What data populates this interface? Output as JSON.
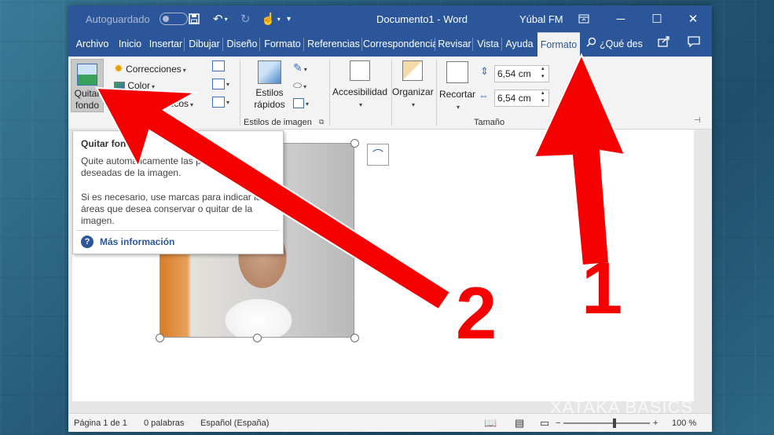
{
  "titlebar": {
    "autosave_label": "Autoguardado",
    "doc_title": "Documento1 - Word",
    "user_name": "Yúbal FM",
    "icons": [
      "save-icon",
      "undo-icon",
      "redo-icon",
      "touch-mode-icon",
      "customize-toolbar-icon",
      "ribbon-display-icon",
      "minimize-icon",
      "maximize-icon",
      "close-icon"
    ]
  },
  "tabs": [
    {
      "label": "Archivo"
    },
    {
      "label": "Inicio"
    },
    {
      "label": "Insertar"
    },
    {
      "label": "Dibujar"
    },
    {
      "label": "Diseño"
    },
    {
      "label": "Formato"
    },
    {
      "label": "Referencias"
    },
    {
      "label": "Correspondencia"
    },
    {
      "label": "Revisar"
    },
    {
      "label": "Vista"
    },
    {
      "label": "Ayuda"
    },
    {
      "label": "Formato"
    }
  ],
  "tell_me": "¿Qué des",
  "ribbon": {
    "quitar_fondo": "Quitar fondo",
    "correcciones": "Correcciones",
    "color": "Color",
    "artisticos_partial": "ísticos",
    "estilos_rapidos": "Estilos rápidos",
    "estilos_group_label": "Estilos de imagen",
    "accesibilidad": "Accesibilidad",
    "organizar": "Organizar",
    "recortar": "Recortar",
    "height_value": "6,54 cm",
    "width_value": "6,54 cm",
    "tamano_group_label": "Tamaño"
  },
  "tooltip": {
    "title": "Quitar fondo",
    "line1": "Quite automáticamente las partes no deseadas de la imagen.",
    "line2": "Si es necesario, use marcas para indicar las áreas que desea conservar o quitar de la imagen.",
    "more_info": "Más información"
  },
  "statusbar": {
    "page": "Página 1 de 1",
    "words": "0 palabras",
    "language": "Español (España)",
    "zoom": "100 %"
  },
  "annotations": {
    "arrow1_number": "1",
    "arrow2_number": "2",
    "color": "#f40000"
  },
  "watermark": "XATAKA BASICS",
  "colors": {
    "word_blue": "#2b579a",
    "ribbon_bg": "#f3f3f3"
  }
}
